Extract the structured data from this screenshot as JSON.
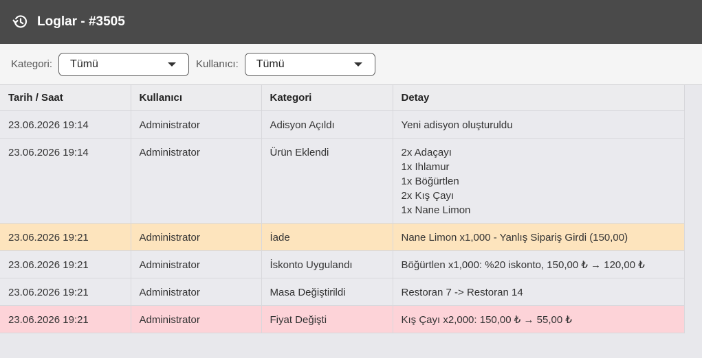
{
  "header": {
    "title": "Loglar - #3505",
    "icon": "history-icon"
  },
  "filters": {
    "category_label": "Kategori:",
    "category_value": "Tümü",
    "user_label": "Kullanıcı:",
    "user_value": "Tümü"
  },
  "table": {
    "columns": [
      "Tarih / Saat",
      "Kullanıcı",
      "Kategori",
      "Detay"
    ],
    "rows": [
      {
        "datetime": "23.06.2026 19:14",
        "user": "Administrator",
        "category": "Adisyon Açıldı",
        "details": [
          "Yeni adisyon oluşturuldu"
        ],
        "highlight": "normal"
      },
      {
        "datetime": "23.06.2026 19:14",
        "user": "Administrator",
        "category": "Ürün Eklendi",
        "details": [
          "2x Adaçayı",
          "1x Ihlamur",
          "1x Böğürtlen",
          "2x Kış Çayı",
          "1x Nane Limon"
        ],
        "highlight": "normal"
      },
      {
        "datetime": "23.06.2026 19:21",
        "user": "Administrator",
        "category": "İade",
        "details": [
          "Nane Limon x1,000 - Yanlış Sipariş Girdi (150,00)"
        ],
        "highlight": "refund"
      },
      {
        "datetime": "23.06.2026 19:21",
        "user": "Administrator",
        "category": "İskonto Uygulandı",
        "details": [
          "Böğürtlen x1,000: %20 iskonto, 150,00 ₺ → 120,00 ₺"
        ],
        "highlight": "normal"
      },
      {
        "datetime": "23.06.2026 19:21",
        "user": "Administrator",
        "category": "Masa Değiştirildi",
        "details": [
          "Restoran 7 -> Restoran 14"
        ],
        "highlight": "normal"
      },
      {
        "datetime": "23.06.2026 19:21",
        "user": "Administrator",
        "category": "Fiyat Değişti",
        "details": [
          "Kış Çayı x2,000: 150,00 ₺ → 55,00 ₺"
        ],
        "highlight": "price"
      }
    ]
  },
  "colors": {
    "header_bg": "#4a4a4a",
    "refund_row": "#fde4bd",
    "price_change_row": "#fdd3d8"
  }
}
